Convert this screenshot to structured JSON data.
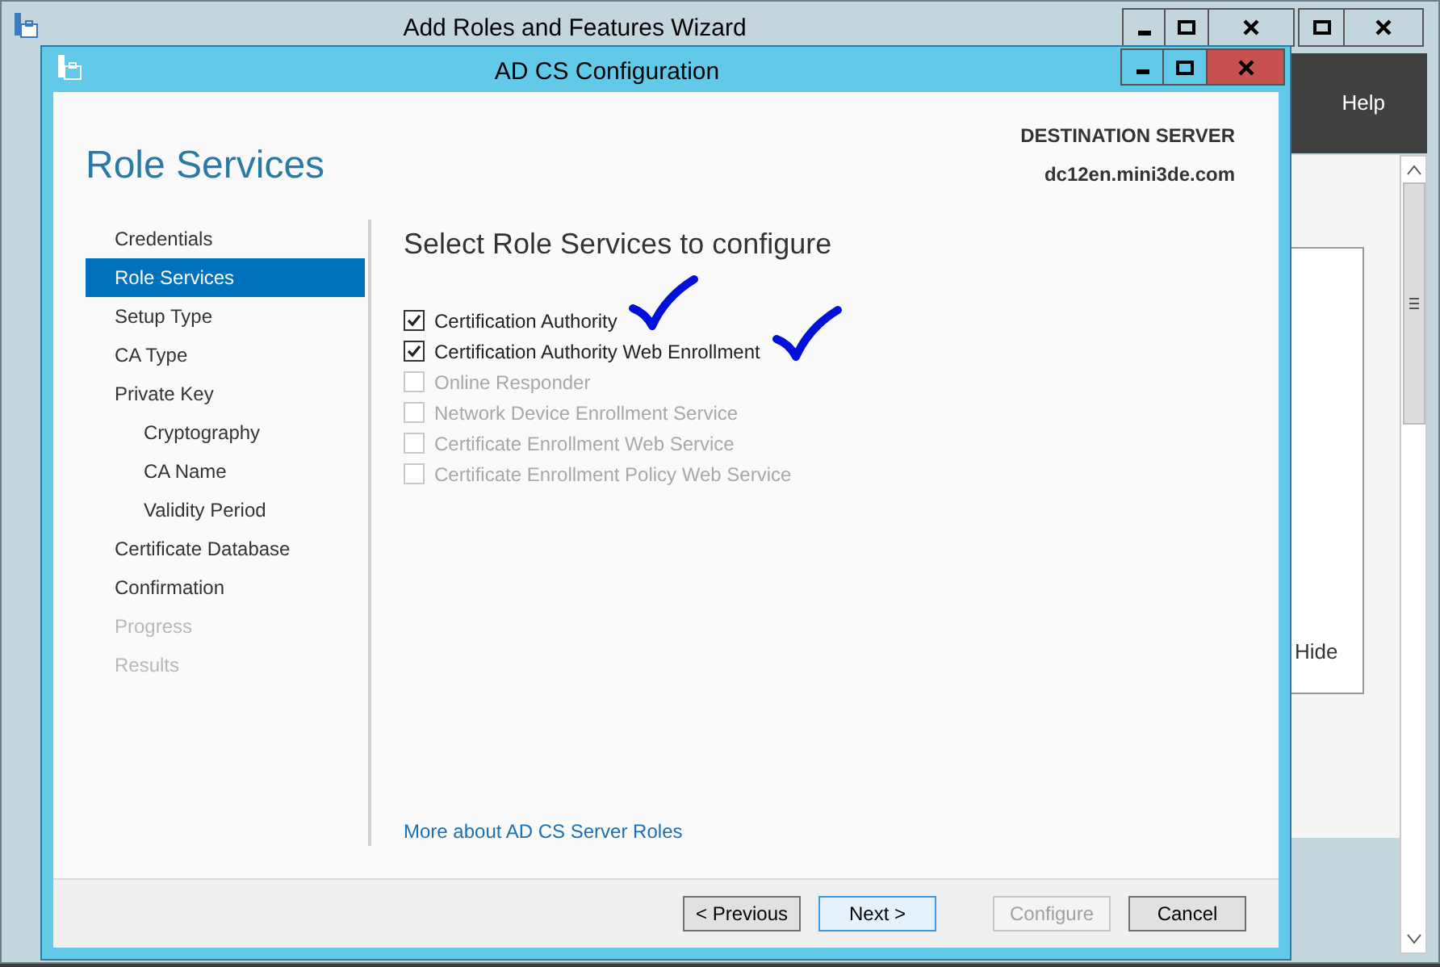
{
  "background_window": {
    "title": "Add Roles and Features Wizard",
    "menu": [
      "Help"
    ],
    "panel_text": "Hide"
  },
  "dialog": {
    "title": "AD CS Configuration"
  },
  "page_title": "Role Services",
  "destination_label": "DESTINATION SERVER",
  "destination_server": "dc12en.mini3de.com",
  "steps": [
    {
      "label": "Credentials",
      "selected": false,
      "disabled": false
    },
    {
      "label": "Role Services",
      "selected": true,
      "disabled": false
    },
    {
      "label": "Setup Type",
      "selected": false,
      "disabled": false
    },
    {
      "label": "CA Type",
      "selected": false,
      "disabled": false
    },
    {
      "label": "Private Key",
      "selected": false,
      "disabled": false,
      "children": [
        {
          "label": "Cryptography",
          "selected": false,
          "disabled": false
        },
        {
          "label": "CA Name",
          "selected": false,
          "disabled": false
        },
        {
          "label": "Validity Period",
          "selected": false,
          "disabled": false
        }
      ]
    },
    {
      "label": "Certificate Database",
      "selected": false,
      "disabled": false
    },
    {
      "label": "Confirmation",
      "selected": false,
      "disabled": false
    },
    {
      "label": "Progress",
      "selected": false,
      "disabled": true
    },
    {
      "label": "Results",
      "selected": false,
      "disabled": true
    }
  ],
  "heading": "Select Role Services to configure",
  "role_services": [
    {
      "label": "Certification Authority",
      "checked": true,
      "disabled": false,
      "annotated": true
    },
    {
      "label": "Certification Authority Web Enrollment",
      "checked": true,
      "disabled": false,
      "annotated": true
    },
    {
      "label": "Online Responder",
      "checked": false,
      "disabled": true,
      "annotated": false
    },
    {
      "label": "Network Device Enrollment Service",
      "checked": false,
      "disabled": true,
      "annotated": false
    },
    {
      "label": "Certificate Enrollment Web Service",
      "checked": false,
      "disabled": true,
      "annotated": false
    },
    {
      "label": "Certificate Enrollment Policy Web Service",
      "checked": false,
      "disabled": true,
      "annotated": false
    }
  ],
  "link": "More about AD CS Server Roles",
  "buttons": [
    {
      "label": "< Previous",
      "disabled": false,
      "default": false
    },
    {
      "label": "Next >",
      "disabled": false,
      "default": true
    },
    {
      "label": "Configure",
      "disabled": true,
      "default": false
    },
    {
      "label": "Cancel",
      "disabled": false,
      "default": false
    }
  ]
}
